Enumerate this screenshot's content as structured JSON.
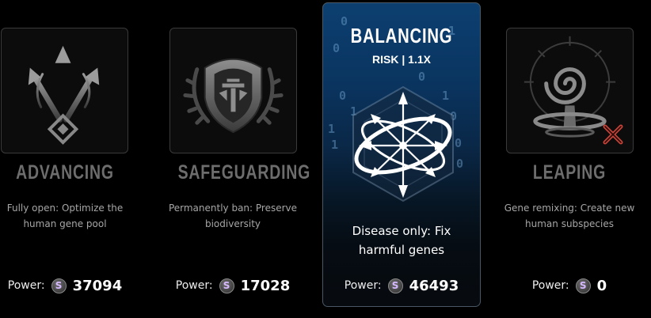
{
  "options": [
    {
      "title": "ADVANCING",
      "description": "Fully open: Optimize the human gene pool",
      "power_label": "Power:",
      "power_value": "37094"
    },
    {
      "title": "SAFEGUARDING",
      "description": "Permanently ban: Preserve biodiversity",
      "power_label": "Power:",
      "power_value": "17028"
    },
    {
      "title": "BALANCING",
      "risk": "RISK | 1.1X",
      "description": "Disease only: Fix harmful genes",
      "power_label": "Power:",
      "power_value": "46493",
      "binary_digits": [
        "0",
        "1",
        "0",
        "0",
        "1",
        "0",
        "1",
        "0",
        "1",
        "0",
        "1",
        "0"
      ]
    },
    {
      "title": "LEAPING",
      "description": "Gene remixing: Create new human subspecies",
      "power_label": "Power:",
      "power_value": "0",
      "unavailable_mark": "x-icon"
    }
  ],
  "power_coin_glyph": "S",
  "colors": {
    "selected_card_top": "#0c3f70",
    "inactive_title": "#6d6d6d",
    "unavailable_mark": "#c8443a"
  }
}
